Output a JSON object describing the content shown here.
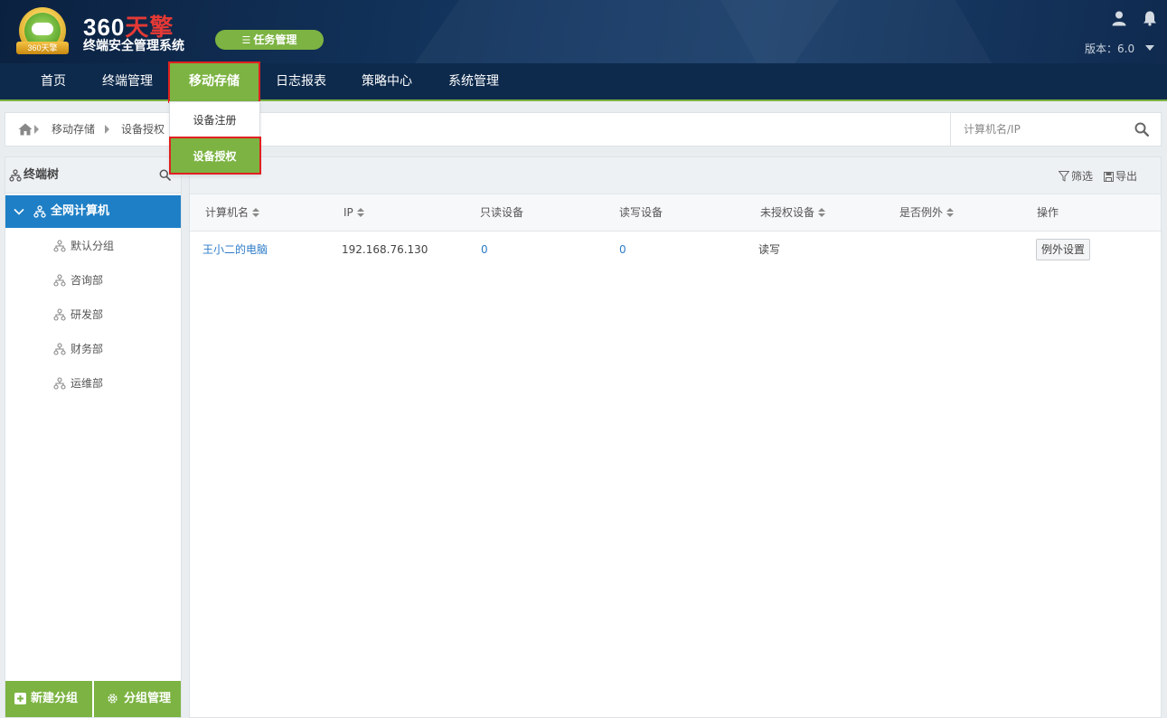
{
  "header": {
    "logo_badge_text": "360天擎",
    "logo_title_prefix": "360",
    "logo_title_suffix": "天擎",
    "logo_subtitle": "终端安全管理系统",
    "task_button": "任务管理",
    "version_label": "版本：6.0"
  },
  "nav": {
    "items": [
      {
        "label": "首页"
      },
      {
        "label": "终端管理"
      },
      {
        "label": "移动存储"
      },
      {
        "label": "日志报表"
      },
      {
        "label": "策略中心"
      },
      {
        "label": "系统管理"
      }
    ],
    "active_index": 2,
    "dropdown": [
      {
        "label": "设备注册"
      },
      {
        "label": "设备授权"
      }
    ]
  },
  "breadcrumb": {
    "items": [
      "移动存储",
      "设备授权"
    ],
    "search_placeholder": "计算机名/IP"
  },
  "sidebar": {
    "title": "终端树",
    "root": "全网计算机",
    "groups": [
      "默认分组",
      "咨询部",
      "研发部",
      "财务部",
      "运维部"
    ],
    "new_group": "新建分组",
    "manage_group": "分组管理"
  },
  "main": {
    "filter": "筛选",
    "export": "导出",
    "columns": [
      "计算机名",
      "IP",
      "只读设备",
      "读写设备",
      "未授权设备",
      "是否例外",
      "操作"
    ],
    "rows": [
      {
        "name": "王小二的电脑",
        "ip": "192.168.76.130",
        "readonly": "0",
        "readwrite": "0",
        "unauthorized": "读写",
        "exception": "",
        "action": "例外设置"
      }
    ]
  },
  "colors": {
    "accent_green": "#7cb342",
    "nav_bg": "#0d2a4c",
    "tree_active": "#1e7fc6",
    "link_blue": "#2d7cc8",
    "highlight_red": "#e02020"
  }
}
